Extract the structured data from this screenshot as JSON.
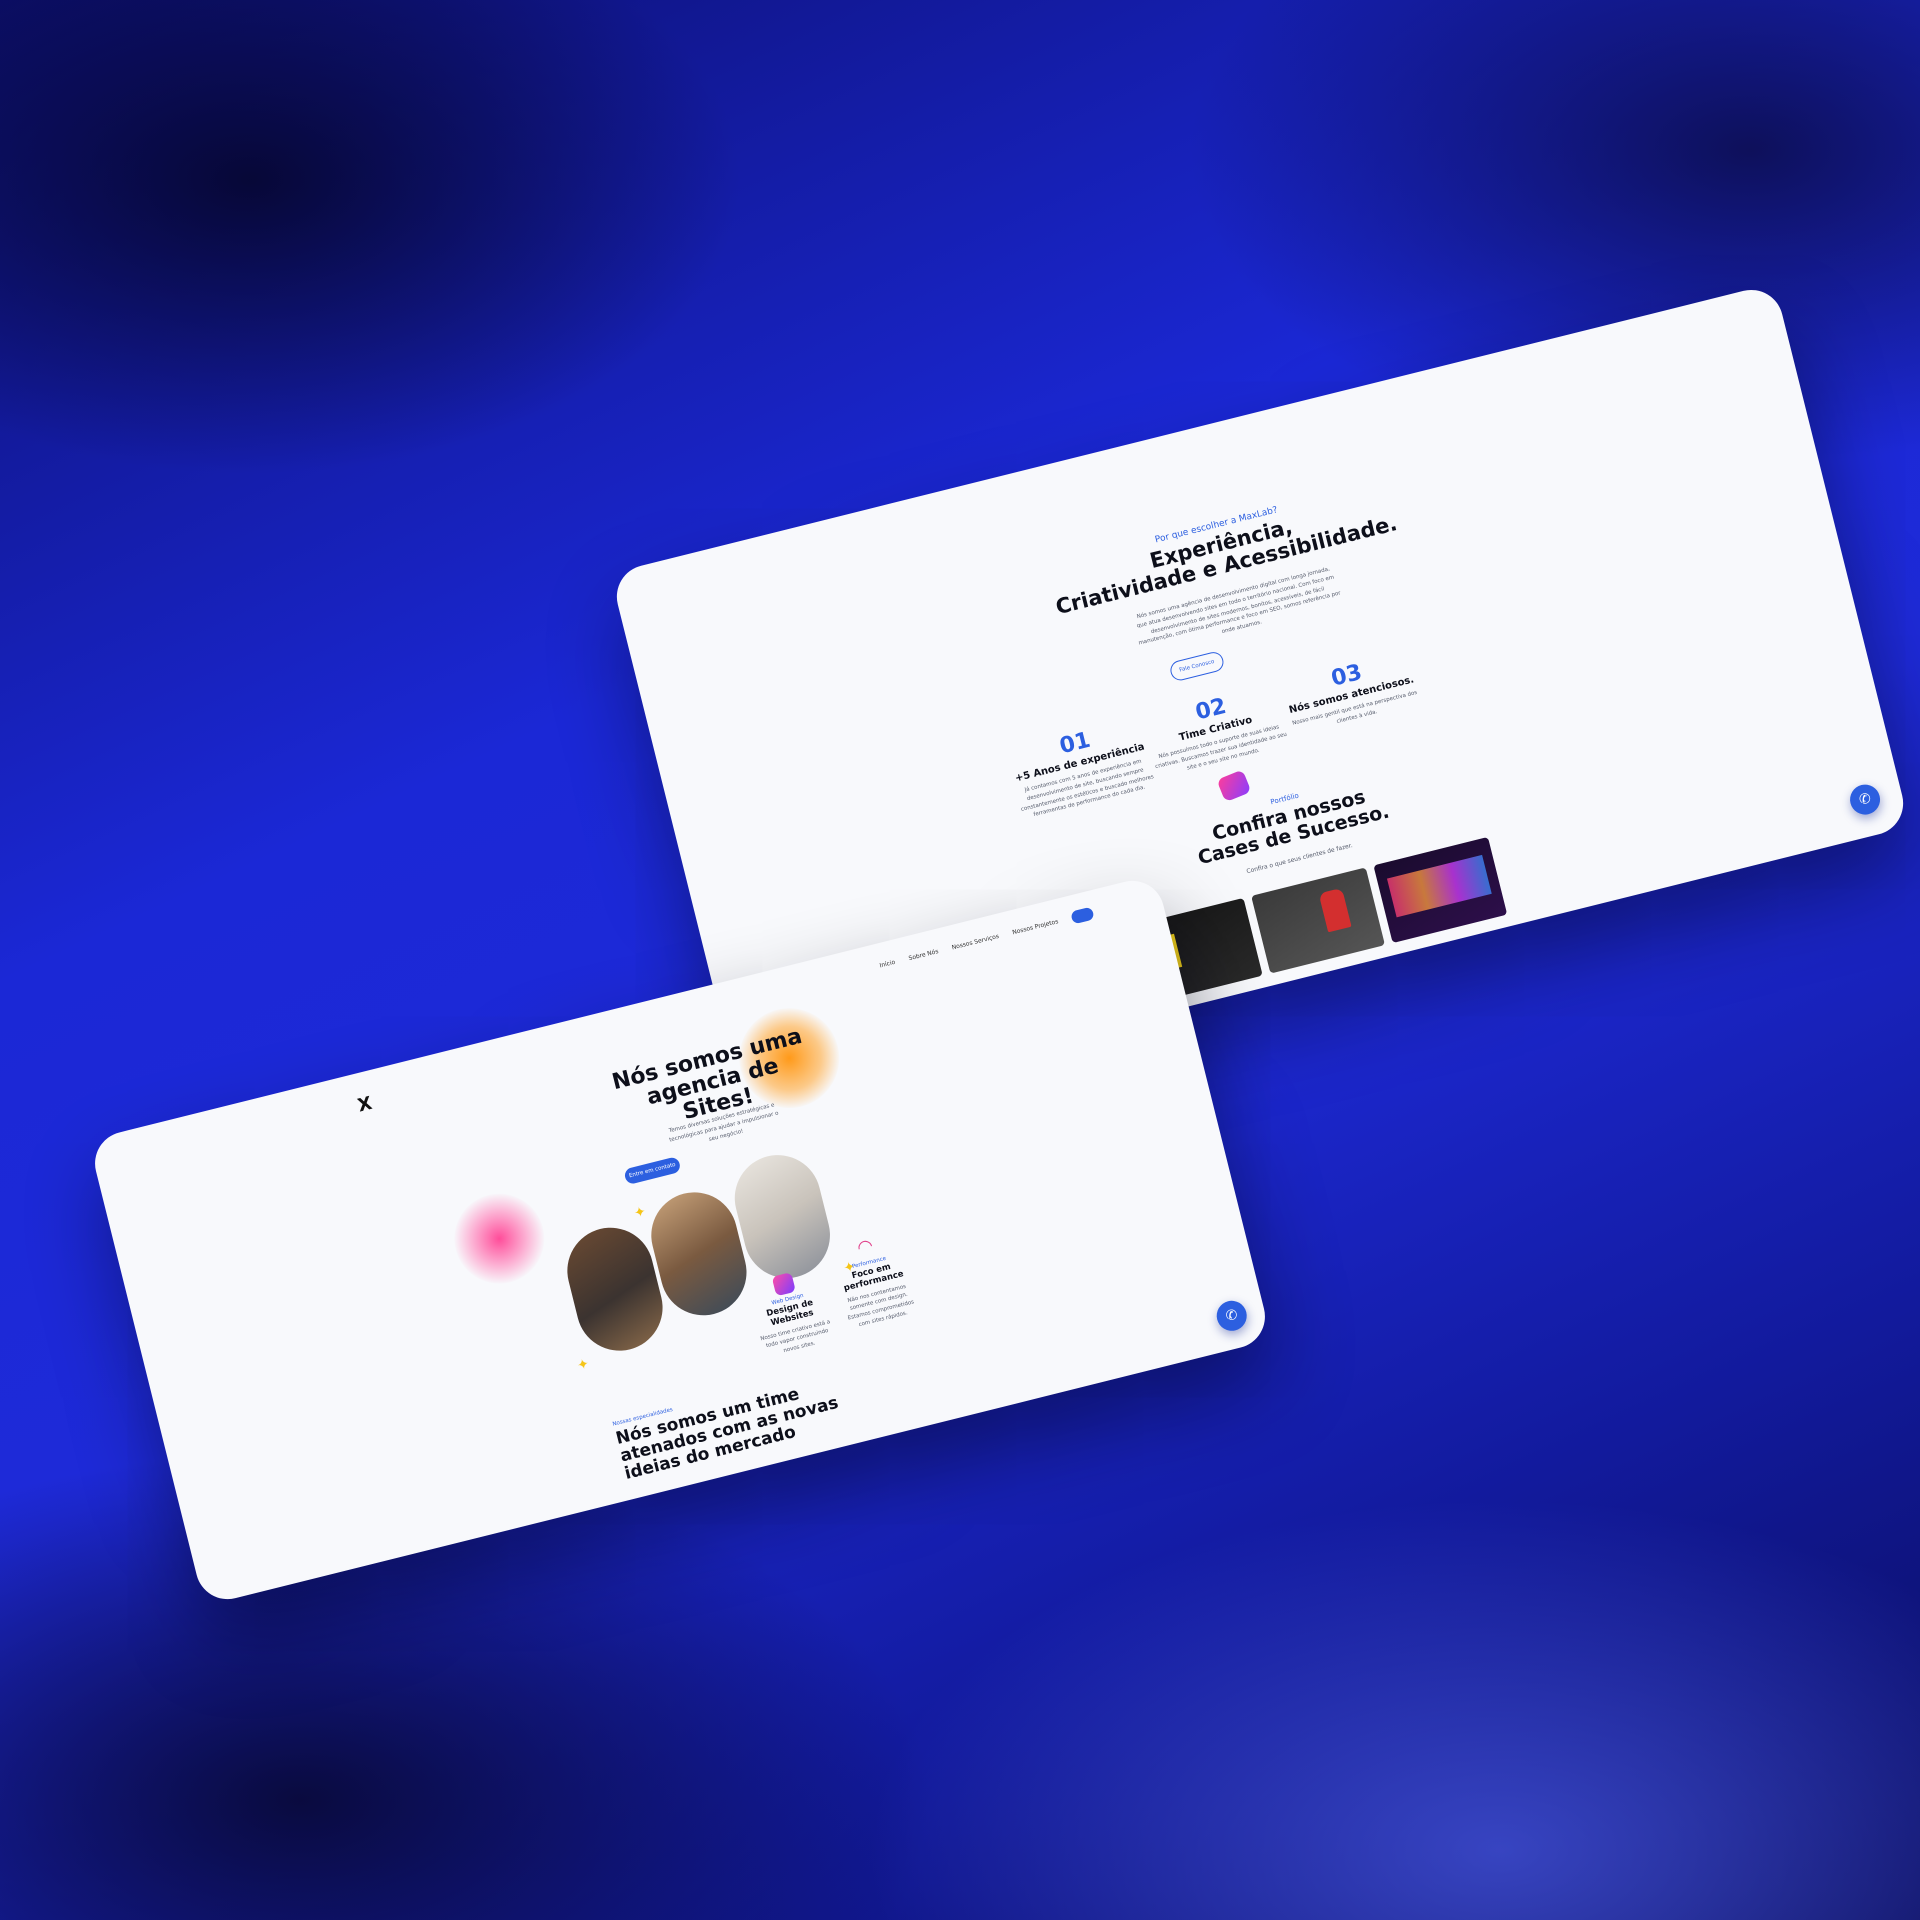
{
  "right_page": {
    "eyebrow": "Por que escolher a MaxLab?",
    "title_line1": "Experiência,",
    "title_line2": "Criatividade e Acessibilidade.",
    "description": "Nós somos uma agência de desenvolvimento digital com longa jornada, que atua desenvolvendo sites em todo o território nacional. Com foco em desenvolvimento de sites modernos, bonitos, acessíveis, de fácil manutenção, com ótima performance e foco em SEO, somos referência por onde atuamos.",
    "cta_label": "Fale Conosco",
    "features": [
      {
        "number": "01",
        "title": "+5 Anos de experiência",
        "text": "Já contamos com 5 anos de experiência em desenvolvimento de site, buscando sempre constantemente os estéticos e buscado melhores ferramentas de performance do cada dia."
      },
      {
        "number": "02",
        "title": "Time Criativo",
        "text": "Nós possuímos todo o suporte de suas ideias criativas. Buscamos trazer sua identidade ao seu site e o seu site no mundo."
      },
      {
        "number": "03",
        "title": "Nós somos atenciosos.",
        "text": "Nosso mais gentil que está na perspectiva dos clientes à vida."
      }
    ],
    "portfolio_eyebrow": "Portfólio",
    "portfolio_title_line1": "Confira nossos",
    "portfolio_title_line2": "Cases de Sucesso.",
    "portfolio_subtitle": "Confira o que seus clientes de fazer."
  },
  "left_page": {
    "logo": "X",
    "nav": [
      "Início",
      "Sobre Nós",
      "Nossos Serviços",
      "Nossos Projetos"
    ],
    "hero_title_line1": "Nós somos uma",
    "hero_title_line2": "agencia de",
    "hero_title_line3": "Sites!",
    "hero_description": "Temos diversas soluções estratégicas e tecnológicas para ajudar a impulsionar o seu negócio!",
    "hero_cta": "Entre em contato",
    "services": [
      {
        "eyebrow": "Web Design",
        "title_line1": "Design de",
        "title_line2": "Websites",
        "text": "Nosso time criativo está a todo vapor construindo novos sites."
      },
      {
        "eyebrow": "Performance",
        "title_line1": "Foco em",
        "title_line2": "performance",
        "text": "Não nos contentamos somente com design. Estamos comprometidos com sites rápidos."
      }
    ],
    "section_eyebrow": "Nossas especialidades",
    "section_title_line1": "Nós somos um time",
    "section_title_line2": "atenados com as novas",
    "section_title_line3": "ideias do mercado"
  },
  "icons": {
    "chat": "whatsapp-icon",
    "sparkle": "sparkle-icon"
  },
  "colors": {
    "accent": "#2c5fe0",
    "background": "#1b28d6",
    "card": "#f8f9fc"
  }
}
